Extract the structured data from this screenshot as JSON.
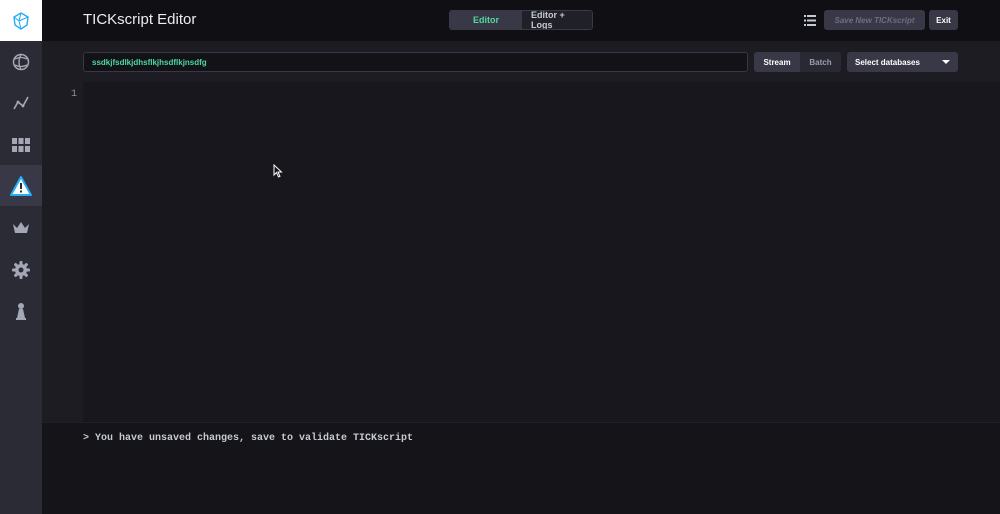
{
  "header": {
    "title": "TICKscript Editor",
    "view_toggle": [
      "Editor",
      "Editor + Logs"
    ],
    "save_label": "Save New TICKscript",
    "exit_label": "Exit"
  },
  "controls": {
    "script_name": "ssdkjfsdlkjdhsflkjhsdflkjnsdfg",
    "type_options": [
      "Stream",
      "Batch"
    ],
    "selected_type": "Stream",
    "db_select_label": "Select databases"
  },
  "editor": {
    "line_numbers": [
      "1"
    ]
  },
  "console": {
    "message": "> You have unsaved changes, save to validate TICKscript"
  },
  "sidebar": {
    "items": [
      {
        "icon": "dashboard-globe-icon"
      },
      {
        "icon": "graph-icon"
      },
      {
        "icon": "grid-icon"
      },
      {
        "icon": "alert-triangle-icon",
        "active": true
      },
      {
        "icon": "crown-icon"
      },
      {
        "icon": "gear-icon"
      },
      {
        "icon": "chess-pawn-icon"
      }
    ]
  },
  "colors": {
    "accent_green": "#4ed8a0",
    "alert_blue": "#22adf6",
    "background": "#141419"
  }
}
